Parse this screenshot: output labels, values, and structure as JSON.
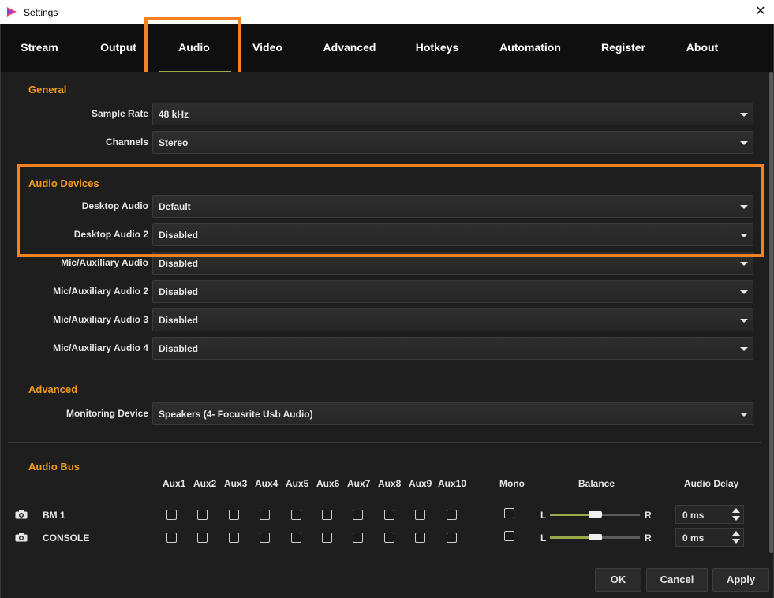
{
  "window": {
    "title": "Settings",
    "close_glyph": "✕"
  },
  "tabs": [
    "Stream",
    "Output",
    "Audio",
    "Video",
    "Advanced",
    "Hotkeys",
    "Automation",
    "Register",
    "About"
  ],
  "active_tab": "Audio",
  "colors": {
    "accent_orange": "#f39c1a",
    "highlight_orange": "#f58220",
    "slider_green": "#9aa94a",
    "background": "#1e1e1e"
  },
  "general": {
    "title": "General",
    "sample_rate": {
      "label": "Sample Rate",
      "value": "48 kHz"
    },
    "channels": {
      "label": "Channels",
      "value": "Stereo"
    }
  },
  "audio_devices": {
    "title": "Audio Devices",
    "fields": [
      {
        "label": "Desktop Audio",
        "value": "Default"
      },
      {
        "label": "Desktop Audio 2",
        "value": "Disabled"
      },
      {
        "label": "Mic/Auxiliary Audio",
        "value": "Disabled"
      },
      {
        "label": "Mic/Auxiliary Audio 2",
        "value": "Disabled"
      },
      {
        "label": "Mic/Auxiliary Audio 3",
        "value": "Disabled"
      },
      {
        "label": "Mic/Auxiliary Audio 4",
        "value": "Disabled"
      }
    ]
  },
  "advanced": {
    "title": "Advanced",
    "monitoring": {
      "label": "Monitoring Device",
      "value": "Speakers (4- Focusrite Usb Audio)"
    }
  },
  "audio_bus": {
    "title": "Audio Bus",
    "aux_headers": [
      "Aux1",
      "Aux2",
      "Aux3",
      "Aux4",
      "Aux5",
      "Aux6",
      "Aux7",
      "Aux8",
      "Aux9",
      "Aux10"
    ],
    "mono_header": "Mono",
    "balance_header": "Balance",
    "delay_header": "Audio Delay",
    "balance_left": "L",
    "balance_right": "R",
    "rows": [
      {
        "name": "BM 1",
        "balance": 0.5,
        "delay": "0 ms"
      },
      {
        "name": "CONSOLE",
        "balance": 0.5,
        "delay": "0 ms"
      }
    ]
  },
  "buttons": {
    "ok": "OK",
    "cancel": "Cancel",
    "apply": "Apply"
  }
}
